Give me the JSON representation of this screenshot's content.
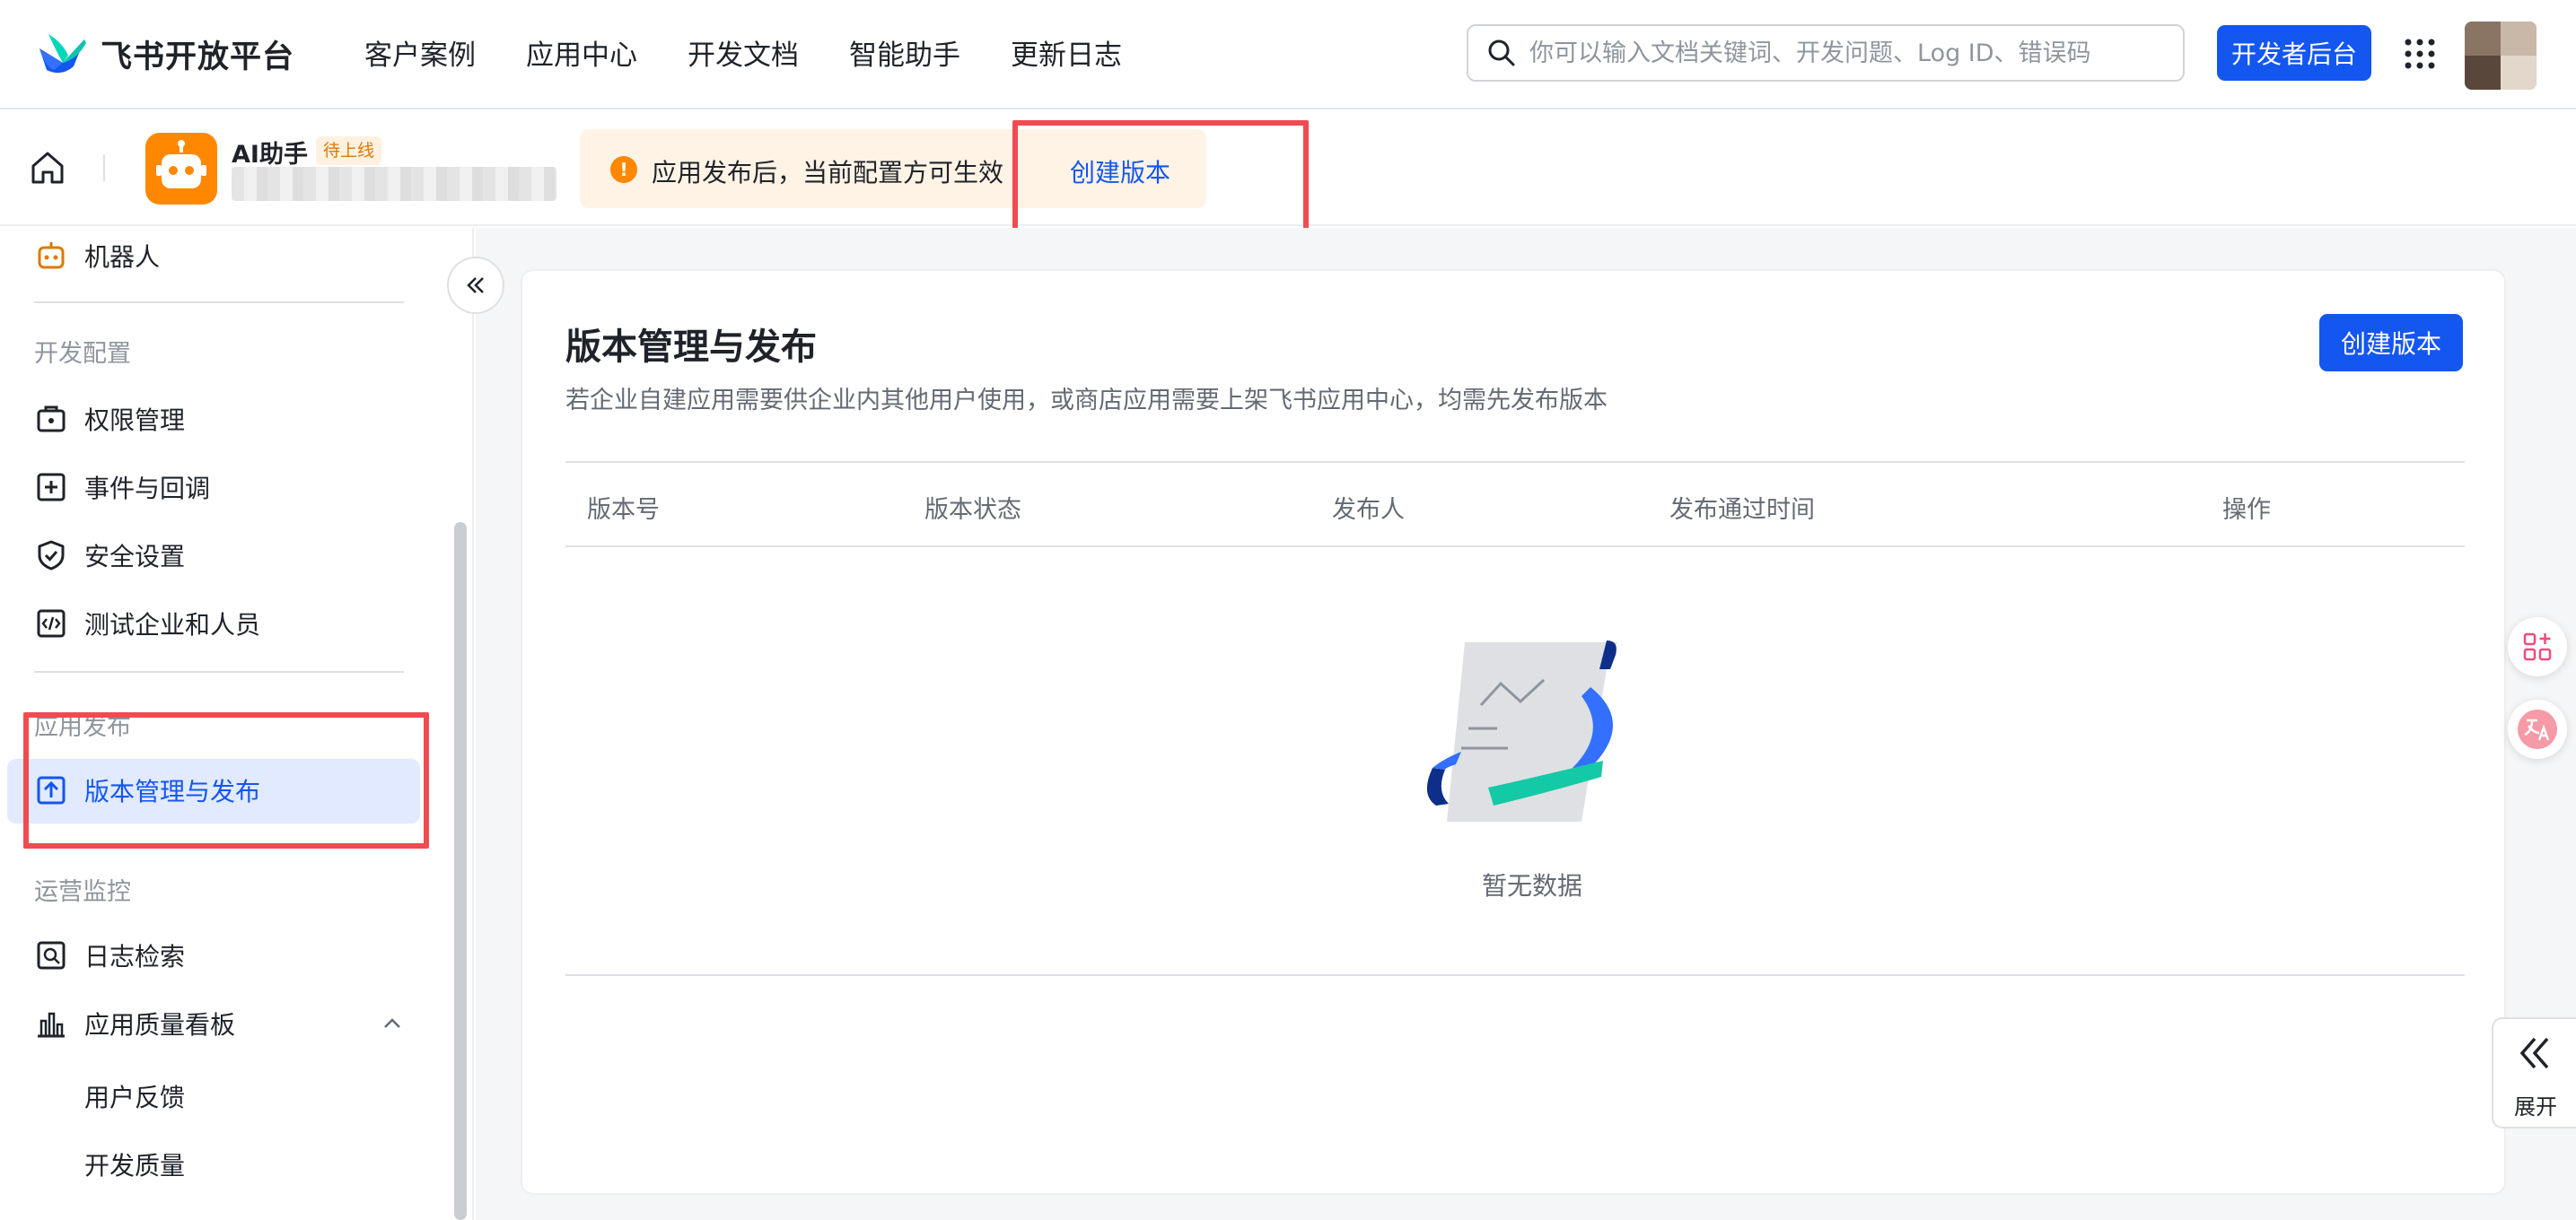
{
  "brand": {
    "name": "飞书开放平台"
  },
  "nav": {
    "links": [
      "客户案例",
      "应用中心",
      "开发文档",
      "智能助手",
      "更新日志"
    ]
  },
  "search": {
    "placeholder": "你可以输入文档关键词、开发问题、Log ID、错误码",
    "value": ""
  },
  "header_actions": {
    "developer_console": "开发者后台"
  },
  "app": {
    "name": "AI助手",
    "status_tag": "待上线"
  },
  "notice": {
    "text": "应用发布后，当前配置方可生效",
    "link": "创建版本",
    "icon": "warning-icon"
  },
  "sidebar": {
    "items_top": [
      {
        "label": "机器人",
        "icon": "robot-icon"
      }
    ],
    "group_dev": "开发配置",
    "dev_items": [
      {
        "label": "权限管理",
        "icon": "permission-icon"
      },
      {
        "label": "事件与回调",
        "icon": "event-icon"
      },
      {
        "label": "安全设置",
        "icon": "shield-icon"
      },
      {
        "label": "测试企业和人员",
        "icon": "code-icon"
      }
    ],
    "group_publish": "应用发布",
    "publish_items": [
      {
        "label": "版本管理与发布",
        "icon": "upload-icon",
        "active": true
      }
    ],
    "group_ops": "运营监控",
    "ops_items": [
      {
        "label": "日志检索",
        "icon": "log-search-icon"
      },
      {
        "label": "应用质量看板",
        "icon": "bar-chart-icon"
      }
    ],
    "quality_sub": [
      "用户反馈",
      "开发质量"
    ]
  },
  "main": {
    "title": "版本管理与发布",
    "description": "若企业自建应用需要供企业内其他用户使用，或商店应用需要上架飞书应用中心，均需先发布版本",
    "create_button": "创建版本",
    "table": {
      "columns": [
        "版本号",
        "版本状态",
        "发布人",
        "发布通过时间",
        "操作"
      ],
      "rows": []
    },
    "empty_text": "暂无数据"
  },
  "right_panel": {
    "expand_label": "展开"
  },
  "colors": {
    "primary": "#1456f0",
    "warning": "#ff8800",
    "highlight": "#f04b51"
  }
}
